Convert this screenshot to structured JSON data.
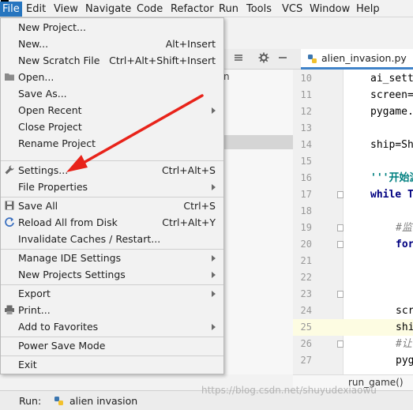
{
  "menubar": {
    "items": [
      "File",
      "Edit",
      "View",
      "Navigate",
      "Code",
      "Refactor",
      "Run",
      "Tools",
      "VCS",
      "Window",
      "Help"
    ],
    "active": "File"
  },
  "file_menu": {
    "items": [
      {
        "label": "New Project...",
        "shortcut": "",
        "submenu": false
      },
      {
        "label": "New...",
        "shortcut": "Alt+Insert",
        "submenu": false
      },
      {
        "label": "New Scratch File",
        "shortcut": "Ctrl+Alt+Shift+Insert",
        "submenu": false
      },
      {
        "label": "Open...",
        "shortcut": "",
        "submenu": false,
        "icon": "folder-icon"
      },
      {
        "label": "Save As...",
        "shortcut": "",
        "submenu": false
      },
      {
        "label": "Open Recent",
        "shortcut": "",
        "submenu": true
      },
      {
        "label": "Close Project",
        "shortcut": "",
        "submenu": false
      },
      {
        "label": "Rename Project",
        "shortcut": "",
        "submenu": false
      },
      {
        "label": "Settings...",
        "shortcut": "Ctrl+Alt+S",
        "submenu": false,
        "icon": "wrench-icon"
      },
      {
        "label": "File Properties",
        "shortcut": "",
        "submenu": true
      },
      {
        "label": "Save All",
        "shortcut": "Ctrl+S",
        "submenu": false,
        "icon": "save-icon"
      },
      {
        "label": "Reload All from Disk",
        "shortcut": "Ctrl+Alt+Y",
        "submenu": false,
        "icon": "reload-icon"
      },
      {
        "label": "Invalidate Caches / Restart...",
        "shortcut": "",
        "submenu": false
      },
      {
        "label": "Manage IDE Settings",
        "shortcut": "",
        "submenu": true
      },
      {
        "label": "New Projects Settings",
        "shortcut": "",
        "submenu": true
      },
      {
        "label": "Export",
        "shortcut": "",
        "submenu": true
      },
      {
        "label": "Print...",
        "shortcut": "",
        "submenu": false,
        "icon": "print-icon"
      },
      {
        "label": "Add to Favorites",
        "shortcut": "",
        "submenu": true
      },
      {
        "label": "Power Save Mode",
        "shortcut": "",
        "submenu": false
      },
      {
        "label": "Exit",
        "shortcut": "",
        "submenu": false
      }
    ]
  },
  "editor": {
    "tab_label": "alien_invasion.py",
    "project_fragment": "n",
    "highlight_line": "25",
    "lines": [
      {
        "num": "10",
        "code": "ai_sett",
        "style": "plain"
      },
      {
        "num": "11",
        "code": "screen=",
        "style": "plain"
      },
      {
        "num": "12",
        "code": "pygame.",
        "style": "plain"
      },
      {
        "num": "13",
        "code": "",
        "style": "plain"
      },
      {
        "num": "14",
        "code": "ship=Sh",
        "style": "plain"
      },
      {
        "num": "15",
        "code": "",
        "style": "plain"
      },
      {
        "num": "16",
        "code": "'''开始游",
        "style": "str"
      },
      {
        "num": "17",
        "code": "while T",
        "style": "kw"
      },
      {
        "num": "18",
        "code": "",
        "style": "plain"
      },
      {
        "num": "19",
        "code": "#监",
        "style": "cm"
      },
      {
        "num": "20",
        "code": "for",
        "style": "kw"
      },
      {
        "num": "21",
        "code": "",
        "style": "plain"
      },
      {
        "num": "22",
        "code": "",
        "style": "plain"
      },
      {
        "num": "23",
        "code": "",
        "style": "plain"
      },
      {
        "num": "24",
        "code": "scr",
        "style": "plain"
      },
      {
        "num": "25",
        "code": "shi",
        "style": "plain"
      },
      {
        "num": "26",
        "code": "#让",
        "style": "cm"
      },
      {
        "num": "27",
        "code": "pyg",
        "style": "plain"
      }
    ],
    "breadcrumb": "run_game()"
  },
  "run_bar": {
    "label": "Run:",
    "tab_label": "alien invasion"
  },
  "watermark": "https://blog.csdn.net/shuyudexiaowu",
  "colors": {
    "menu_active": "#2675bf",
    "arrow": "#e8231a",
    "tab_underline": "#4083c9"
  }
}
